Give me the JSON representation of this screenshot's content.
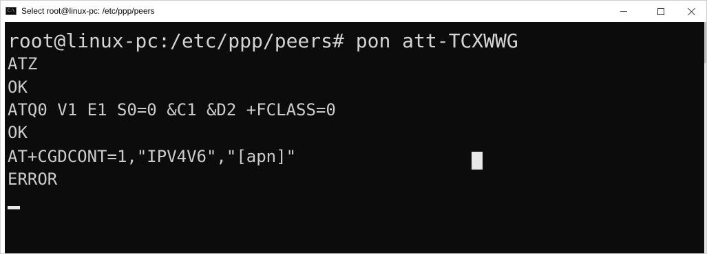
{
  "window": {
    "title": "Select root@linux-pc: /etc/ppp/peers",
    "icon": "console-icon",
    "controls": {
      "minimize": "minimize-icon",
      "maximize": "maximize-icon",
      "close": "close-icon"
    }
  },
  "terminal": {
    "background": "#0c0c0c",
    "foreground": "#cccccc",
    "prompt_line": "root@linux-pc:/etc/ppp/peers# pon att-TCXWWG",
    "lines": [
      "ATZ",
      "OK",
      "ATQ0 V1 E1 S0=0 &C1 &D2 +FCLASS=0",
      "OK",
      "AT+CGDCONT=1,\"IPV4V6\",\"[apn]\"",
      "ERROR"
    ]
  }
}
